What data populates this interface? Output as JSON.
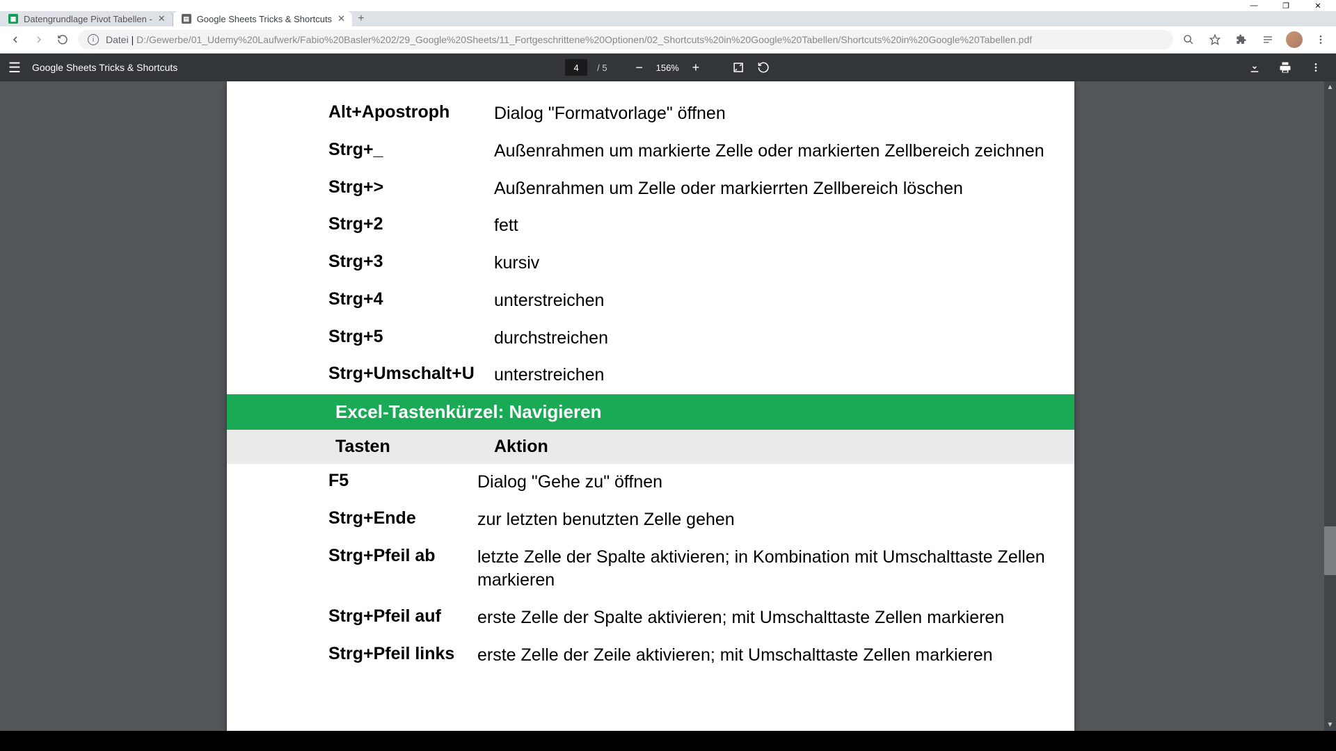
{
  "window": {
    "minimize": "—",
    "maximize": "❐",
    "close": "✕"
  },
  "tabs": [
    {
      "title": "Datengrundlage Pivot Tabellen -",
      "active": false
    },
    {
      "title": "Google Sheets Tricks & Shortcuts",
      "active": true
    }
  ],
  "addressbar": {
    "scheme": "Datei",
    "path": "D:/Gewerbe/01_Udemy%20Laufwerk/Fabio%20Basler%202/29_Google%20Sheets/11_Fortgeschrittene%20Optionen/02_Shortcuts%20in%20Google%20Tabellen/Shortcuts%20in%20Google%20Tabellen.pdf"
  },
  "pdf": {
    "title": "Google Sheets Tricks & Shortcuts",
    "page_current": "4",
    "page_total": "/  5",
    "zoom": "156%"
  },
  "shortcuts_top": [
    {
      "key": "Alt+Apostroph",
      "action": "Dialog \"Formatvorlage\" öffnen"
    },
    {
      "key": "Strg+_",
      "action": "Außenrahmen um markierte Zelle oder markierten Zellbereich zeichnen"
    },
    {
      "key": "Strg+>",
      "action": "Außenrahmen um Zelle oder markierrten Zellbereich löschen"
    },
    {
      "key": "Strg+2",
      "action": "fett"
    },
    {
      "key": "Strg+3",
      "action": "kursiv"
    },
    {
      "key": "Strg+4",
      "action": "unterstreichen"
    },
    {
      "key": "Strg+5",
      "action": "durchstreichen"
    },
    {
      "key": "Strg+Umschalt+U",
      "action": "unterstreichen"
    }
  ],
  "section2": {
    "title": "Excel-Tastenkürzel: Navigieren",
    "head_key": "Tasten",
    "head_action": "Aktion",
    "rows": [
      {
        "key": "F5",
        "action": "Dialog \"Gehe zu\" öffnen"
      },
      {
        "key": "Strg+Ende",
        "action": "zur letzten benutzten Zelle gehen"
      },
      {
        "key": "Strg+Pfeil ab",
        "action": "letzte Zelle der Spalte aktivieren; in Kombination mit Umschalttaste Zellen markieren"
      },
      {
        "key": "Strg+Pfeil auf",
        "action": "erste Zelle der Spalte aktivieren; mit Umschalttaste Zellen markieren"
      },
      {
        "key": "Strg+Pfeil links",
        "action": "erste Zelle der Zeile aktivieren; mit Umschalttaste Zellen markieren"
      }
    ]
  }
}
